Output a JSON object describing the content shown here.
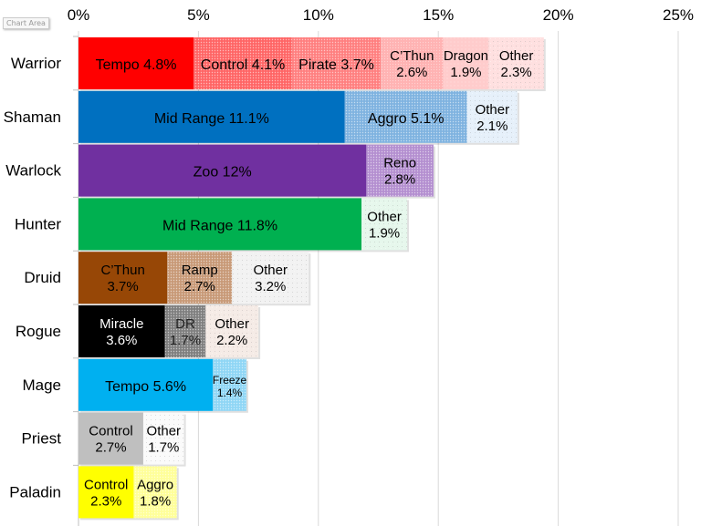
{
  "tooltip": "Chart Area",
  "chart_data": {
    "type": "bar",
    "orientation": "horizontal",
    "stacked": true,
    "title": "",
    "xlabel": "",
    "ylabel": "",
    "xlim": [
      0,
      25
    ],
    "x_ticks": [
      "0%",
      "5%",
      "10%",
      "15%",
      "20%",
      "25%"
    ],
    "x_tick_values": [
      0,
      5,
      10,
      15,
      20,
      25
    ],
    "axis_position": "top",
    "grid": true,
    "categories": [
      "Warrior",
      "Shaman",
      "Warlock",
      "Hunter",
      "Druid",
      "Rogue",
      "Mage",
      "Priest",
      "Paladin"
    ],
    "rows": [
      {
        "class": "Warrior",
        "segments": [
          {
            "name": "Tempo",
            "value": 4.8,
            "label": [
              "Tempo 4.8%"
            ],
            "color": "#ff0000",
            "pattern": "solid",
            "text": "#000"
          },
          {
            "name": "Control",
            "value": 4.1,
            "label": [
              "Control 4.1%"
            ],
            "color": "#ff6666",
            "pattern": "dense",
            "text": "#000"
          },
          {
            "name": "Pirate",
            "value": 3.7,
            "label": [
              "Pirate 3.7%"
            ],
            "color": "#ff8080",
            "pattern": "dense",
            "text": "#000"
          },
          {
            "name": "C'Thun",
            "value": 2.6,
            "label": [
              "C’Thun",
              "2.6%"
            ],
            "color": "#ffb3b3",
            "pattern": "medium",
            "text": "#000"
          },
          {
            "name": "Dragon",
            "value": 1.9,
            "label": [
              "Dragon",
              "1.9%"
            ],
            "color": "#ffcccc",
            "pattern": "light",
            "text": "#000"
          },
          {
            "name": "Other",
            "value": 2.3,
            "label": [
              "Other",
              "2.3%"
            ],
            "color": "#ffe0e0",
            "pattern": "sparse",
            "text": "#000"
          }
        ]
      },
      {
        "class": "Shaman",
        "segments": [
          {
            "name": "Mid Range",
            "value": 11.1,
            "label": [
              "Mid Range 11.1%"
            ],
            "color": "#0070c0",
            "pattern": "solid",
            "text": "#000"
          },
          {
            "name": "Aggro",
            "value": 5.1,
            "label": [
              "Aggro 5.1%"
            ],
            "color": "#7fb3e0",
            "pattern": "dense",
            "text": "#000"
          },
          {
            "name": "Other",
            "value": 2.1,
            "label": [
              "Other",
              "2.1%"
            ],
            "color": "#e6f0fa",
            "pattern": "sparse",
            "text": "#000"
          }
        ]
      },
      {
        "class": "Warlock",
        "segments": [
          {
            "name": "Zoo",
            "value": 12.0,
            "label": [
              "Zoo 12%"
            ],
            "color": "#7030a0",
            "pattern": "solid",
            "text": "#000"
          },
          {
            "name": "Reno",
            "value": 2.8,
            "label": [
              "Reno",
              "2.8%"
            ],
            "color": "#b48fd0",
            "pattern": "dense",
            "text": "#000"
          }
        ]
      },
      {
        "class": "Hunter",
        "segments": [
          {
            "name": "Mid Range",
            "value": 11.8,
            "label": [
              "Mid Range 11.8%"
            ],
            "color": "#00b050",
            "pattern": "solid",
            "text": "#000"
          },
          {
            "name": "Other",
            "value": 1.9,
            "label": [
              "Other",
              "1.9%"
            ],
            "color": "#e6f7ec",
            "pattern": "sparse",
            "text": "#000"
          }
        ]
      },
      {
        "class": "Druid",
        "segments": [
          {
            "name": "C'Thun",
            "value": 3.7,
            "label": [
              "C’Thun",
              "3.7%"
            ],
            "color": "#974706",
            "pattern": "solid",
            "text": "#000"
          },
          {
            "name": "Ramp",
            "value": 2.7,
            "label": [
              "Ramp",
              "2.7%"
            ],
            "color": "#c89a78",
            "pattern": "dense",
            "text": "#000"
          },
          {
            "name": "Other",
            "value": 3.2,
            "label": [
              "Other",
              "3.2%"
            ],
            "color": "#f2f2f2",
            "pattern": "sparse",
            "text": "#000"
          }
        ]
      },
      {
        "class": "Rogue",
        "segments": [
          {
            "name": "Miracle",
            "value": 3.6,
            "label": [
              "Miracle",
              "3.6%"
            ],
            "color": "#000000",
            "pattern": "solid",
            "text": "#fff"
          },
          {
            "name": "DR",
            "value": 1.7,
            "label": [
              "DR",
              "1.7%"
            ],
            "color": "#808080",
            "pattern": "dense",
            "text": "#222"
          },
          {
            "name": "Other",
            "value": 2.2,
            "label": [
              "Other",
              "2.2%"
            ],
            "color": "#f5ebe6",
            "pattern": "sparse",
            "text": "#000"
          }
        ]
      },
      {
        "class": "Mage",
        "segments": [
          {
            "name": "Tempo",
            "value": 5.6,
            "label": [
              "Tempo 5.6%"
            ],
            "color": "#00b0f0",
            "pattern": "solid",
            "text": "#000"
          },
          {
            "name": "Freeze",
            "value": 1.4,
            "label": [
              "Freeze",
              "1.4%"
            ],
            "color": "#8fd6f5",
            "pattern": "dense",
            "text": "#000"
          }
        ]
      },
      {
        "class": "Priest",
        "segments": [
          {
            "name": "Control",
            "value": 2.7,
            "label": [
              "Control",
              "2.7%"
            ],
            "color": "#bfbfbf",
            "pattern": "solid",
            "text": "#000"
          },
          {
            "name": "Other",
            "value": 1.7,
            "label": [
              "Other",
              "1.7%"
            ],
            "color": "#fafafa",
            "pattern": "sparse",
            "text": "#000"
          }
        ]
      },
      {
        "class": "Paladin",
        "segments": [
          {
            "name": "Control",
            "value": 2.3,
            "label": [
              "Control",
              "2.3%"
            ],
            "color": "#ffff00",
            "pattern": "solid",
            "text": "#000"
          },
          {
            "name": "Aggro",
            "value": 1.8,
            "label": [
              "Aggro",
              "1.8%"
            ],
            "color": "#ffff99",
            "pattern": "dense",
            "text": "#000"
          }
        ]
      }
    ]
  }
}
